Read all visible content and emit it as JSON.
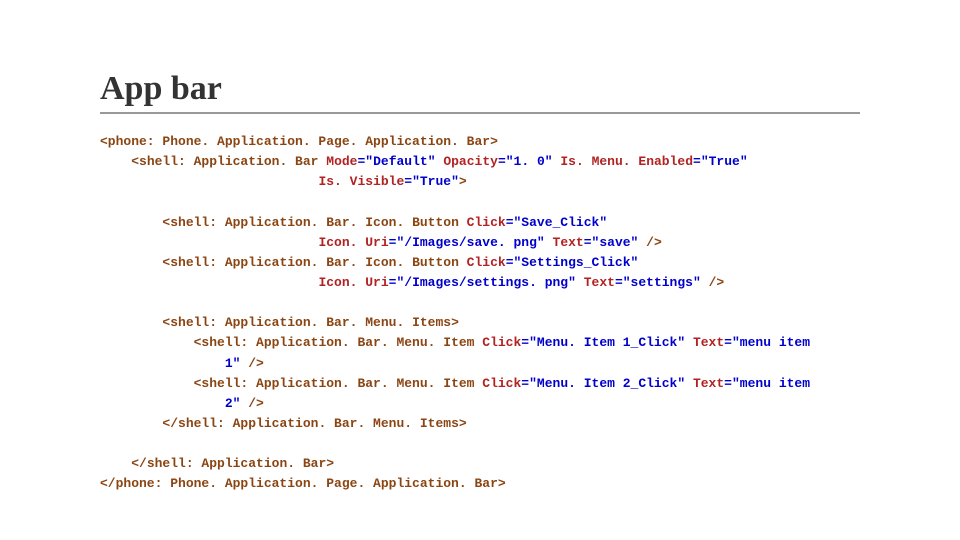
{
  "title": "App bar",
  "code": {
    "l1_tag": "<phone: Phone. Application. Page. Application. Bar>",
    "l2_tag": "<shell: Application. Bar ",
    "l2_attr1": "Mode",
    "l2_val1": "\"Default\"",
    "l2_attr2": "Opacity",
    "l2_val2": "\"1. 0\"",
    "l2_attr3": "Is. Menu. Enabled",
    "l2_val3": "\"True\"",
    "l3_attr": "Is. Visible",
    "l3_val": "\"True\"",
    "l3_close": ">",
    "l4_tag": "<shell: Application. Bar. Icon. Button ",
    "l4_attr1": "Click",
    "l4_val1": "\"Save_Click\"",
    "l5_attr1": "Icon. Uri",
    "l5_val1": "\"/Images/save. png\"",
    "l5_attr2": "Text",
    "l5_val2": "\"save\"",
    "l5_close": " />",
    "l6_tag": "<shell: Application. Bar. Icon. Button ",
    "l6_attr1": "Click",
    "l6_val1": "\"Settings_Click\"",
    "l7_attr1": "Icon. Uri",
    "l7_val1": "\"/Images/settings. png\"",
    "l7_attr2": "Text",
    "l7_val2": "\"settings\"",
    "l7_close": " />",
    "l8_tag": "<shell: Application. Bar. Menu. Items>",
    "l9_tag": "<shell: Application. Bar. Menu. Item ",
    "l9_attr1": "Click",
    "l9_val1": "\"Menu. Item 1_Click\"",
    "l9_attr2": "Text",
    "l9_val2_a": "\"menu",
    "l9_val2_b": "item",
    "l10_val": "1\"",
    "l10_close": " />",
    "l11_tag": "<shell: Application. Bar. Menu. Item ",
    "l11_attr1": "Click",
    "l11_val1": "\"Menu. Item 2_Click\"",
    "l11_attr2": "Text",
    "l11_val2_a": "\"menu",
    "l11_val2_b": "item",
    "l12_val": "2\"",
    "l12_close": " />",
    "l13_tag": "</shell: Application. Bar. Menu. Items>",
    "l14_tag": "</shell: Application. Bar>",
    "l15_tag": "</phone: Phone. Application. Page. Application. Bar>"
  }
}
